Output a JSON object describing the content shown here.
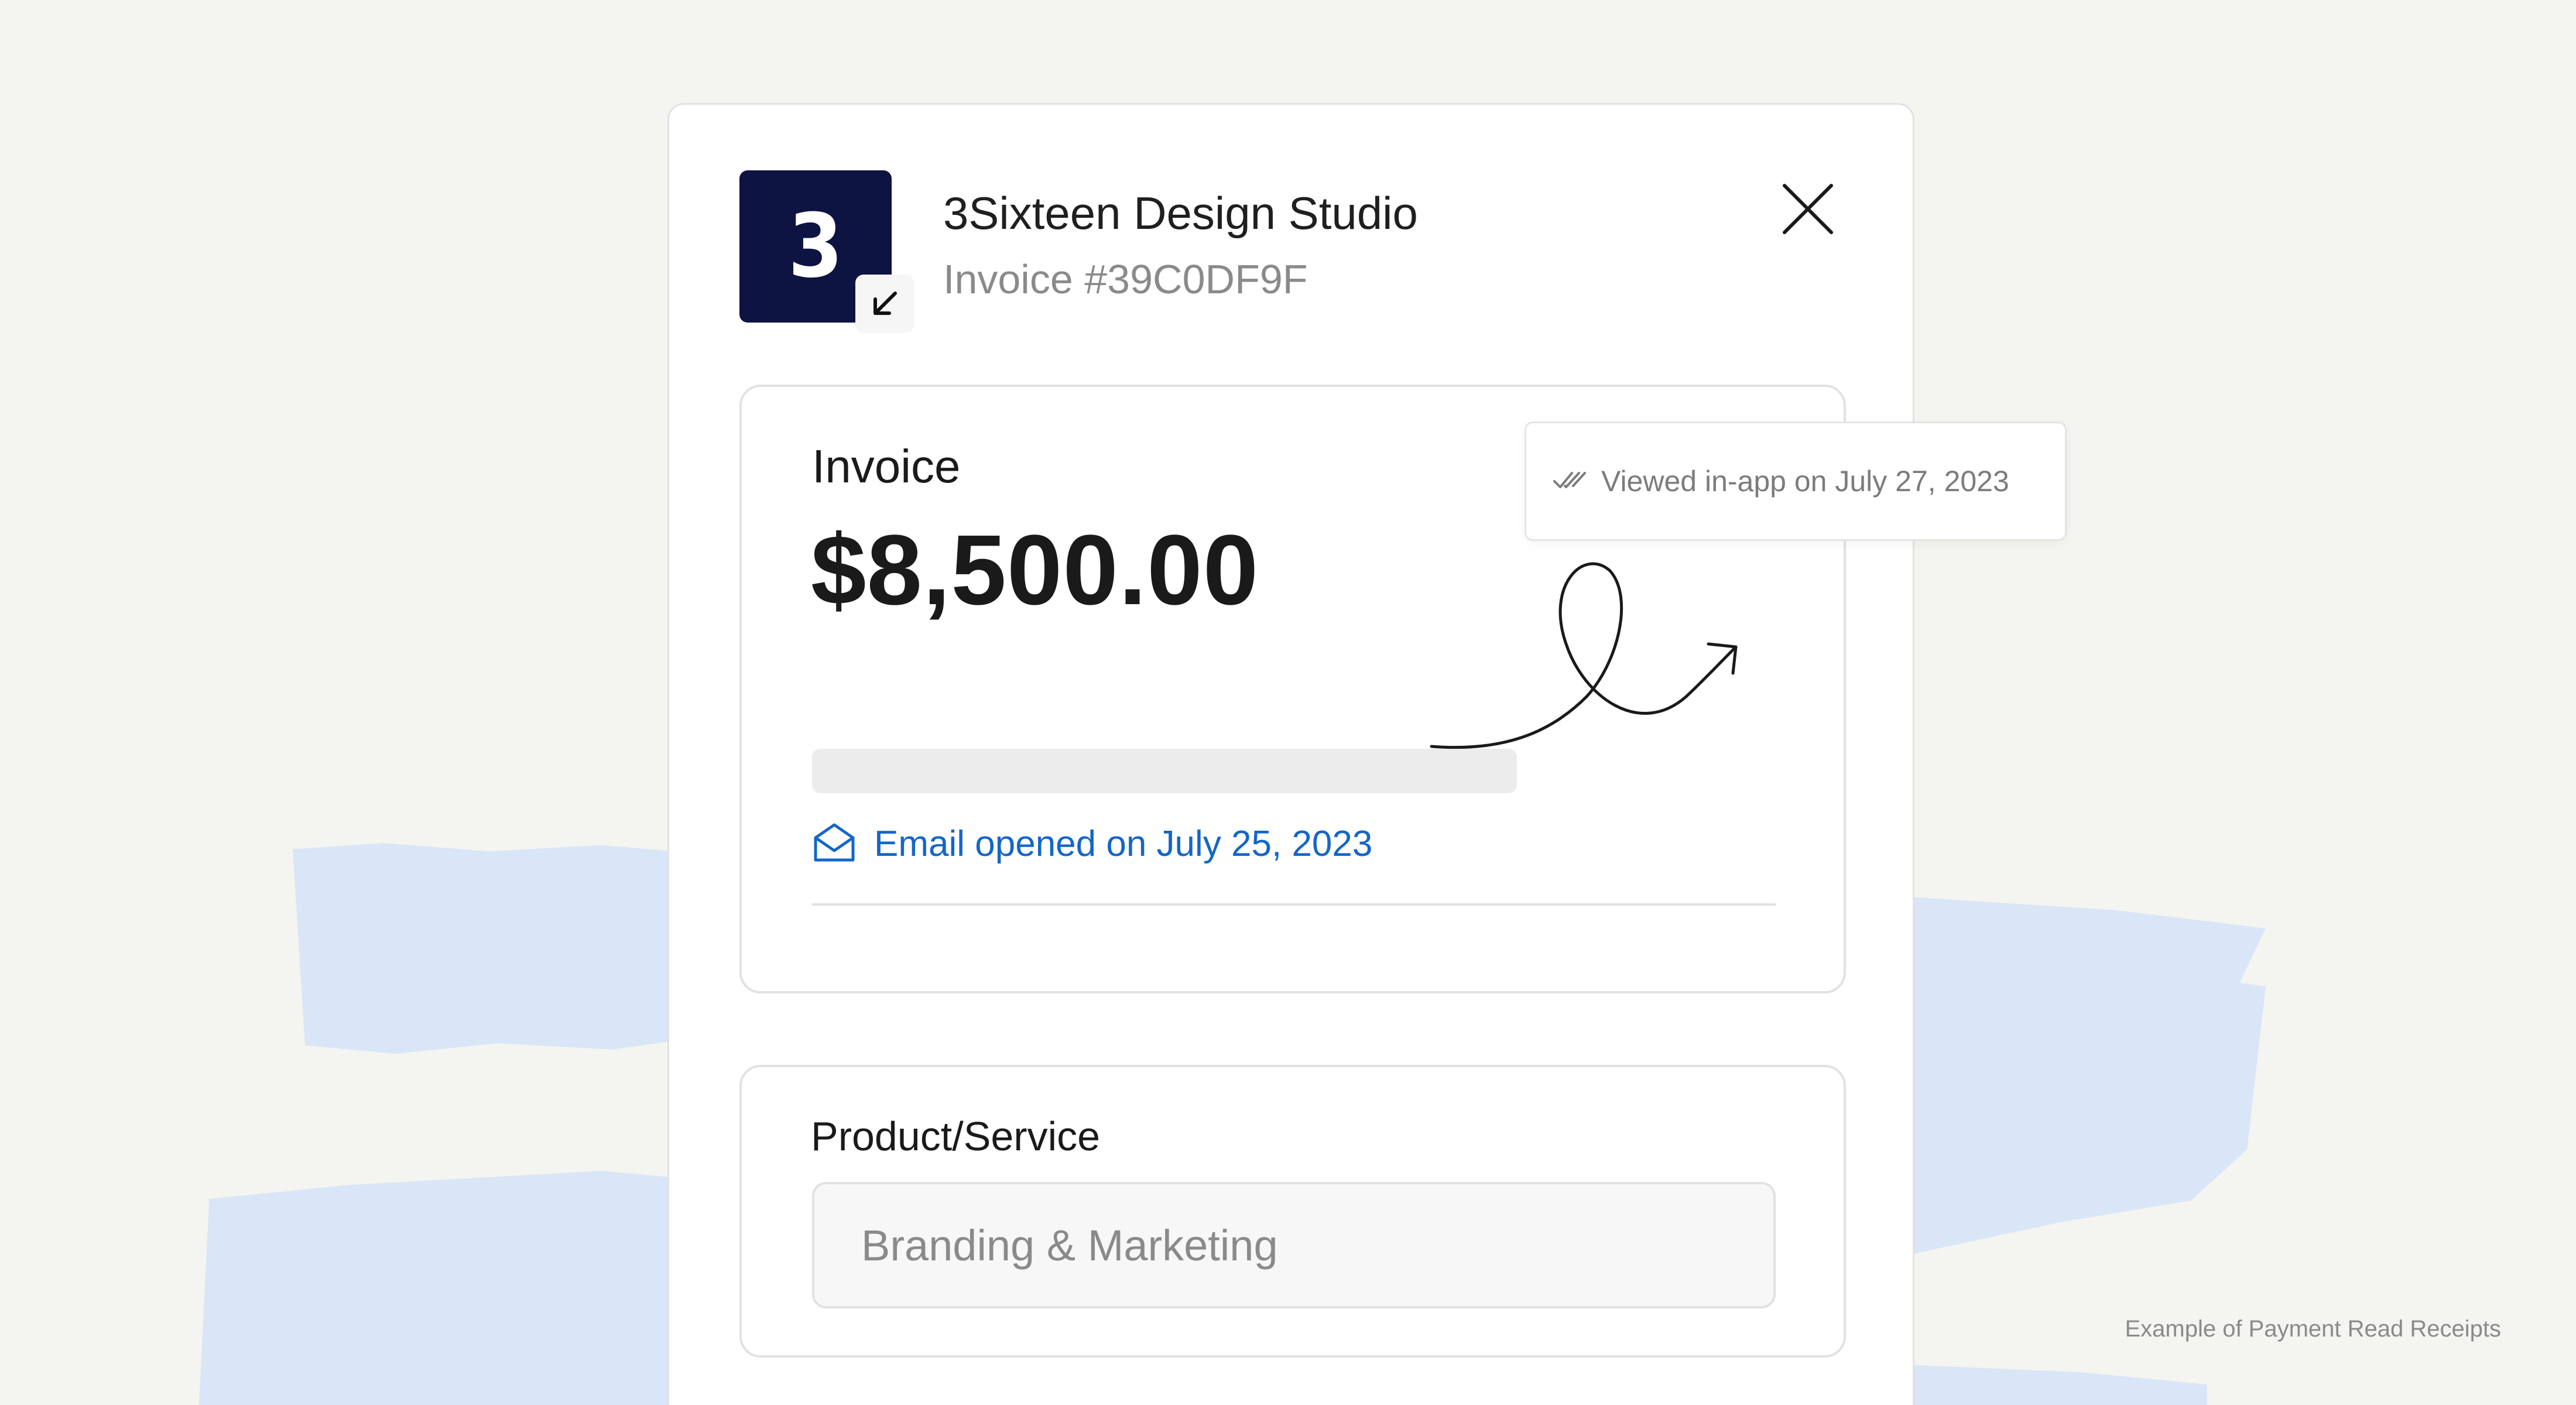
{
  "header": {
    "logo_text": "3",
    "company_name": "3Sixteen Design Studio",
    "invoice_number": "Invoice #39C0DF9F"
  },
  "invoice_card": {
    "label": "Invoice",
    "amount": "$8,500.00",
    "email_status": "Email opened on July 25, 2023"
  },
  "read_receipt": {
    "text": "Viewed in-app on July 27, 2023"
  },
  "product_card": {
    "label": "Product/Service",
    "value": "Branding & Marketing"
  },
  "caption": "Example of Payment Read Receipts",
  "colors": {
    "logo_bg": "#0d1442",
    "accent_blue": "#1466c8",
    "page_bg": "#f4f4f0",
    "brush_blue": "#d9e6f7"
  },
  "icons": [
    "arrow-down-left-icon",
    "close-icon",
    "envelope-open-icon",
    "double-check-icon",
    "squiggle-arrow-icon"
  ]
}
